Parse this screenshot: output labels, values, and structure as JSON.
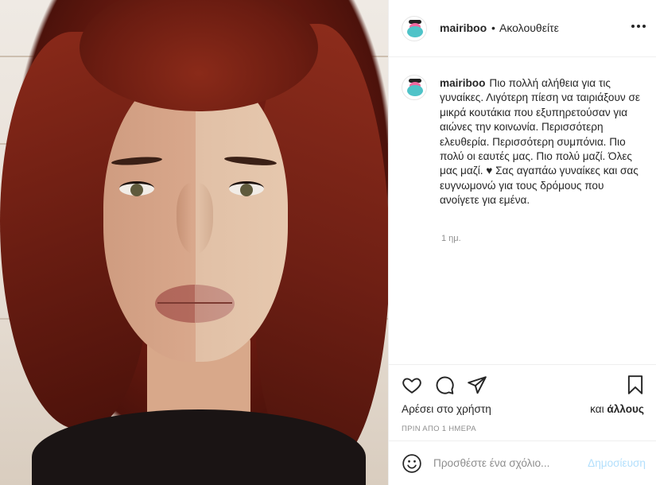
{
  "post": {
    "username": "mairiboo",
    "separator": "•",
    "follow_status": "Ακολουθείτε",
    "more_icon": "more-horizontal-icon",
    "caption_text": "Πιο πολλή αλήθεια για τις γυναίκες. Λιγότερη πίεση να ταιριάξουν σε μικρά κουτάκια που εξυπηρετούσαν για αιώνες την κοινωνία. Περισσότερη ελευθερία. Περισσότερη συμπόνια. Πιο πολύ οι εαυτές μας. Πιο πολύ μαζί. Όλες μας μαζί. ♥ Σας αγαπάω γυναίκες και σας ευγνωμονώ για τους δρόμους που ανοίγετε για εμένα.",
    "relative_time": "1 ημ.",
    "liked_by_prefix": "Αρέσει στο χρήστη",
    "liked_by_suffix_pre": "και ",
    "liked_by_suffix_bold": "άλλους",
    "date_label": "ΠΡΙΝ ΑΠΟ 1 ΗΜΕΡΑ"
  },
  "actions": {
    "like_icon": "heart-icon",
    "comment_icon": "comment-icon",
    "share_icon": "share-icon",
    "save_icon": "bookmark-icon"
  },
  "comment": {
    "emoji_icon": "smiley-icon",
    "placeholder": "Προσθέστε ένα σχόλιο...",
    "post_label": "Δημοσίευση"
  },
  "colors": {
    "text": "#262626",
    "secondary": "#8e8e8e",
    "border": "#efefef",
    "post_button_disabled": "#b2dffc",
    "hair": "#6a1d12"
  }
}
